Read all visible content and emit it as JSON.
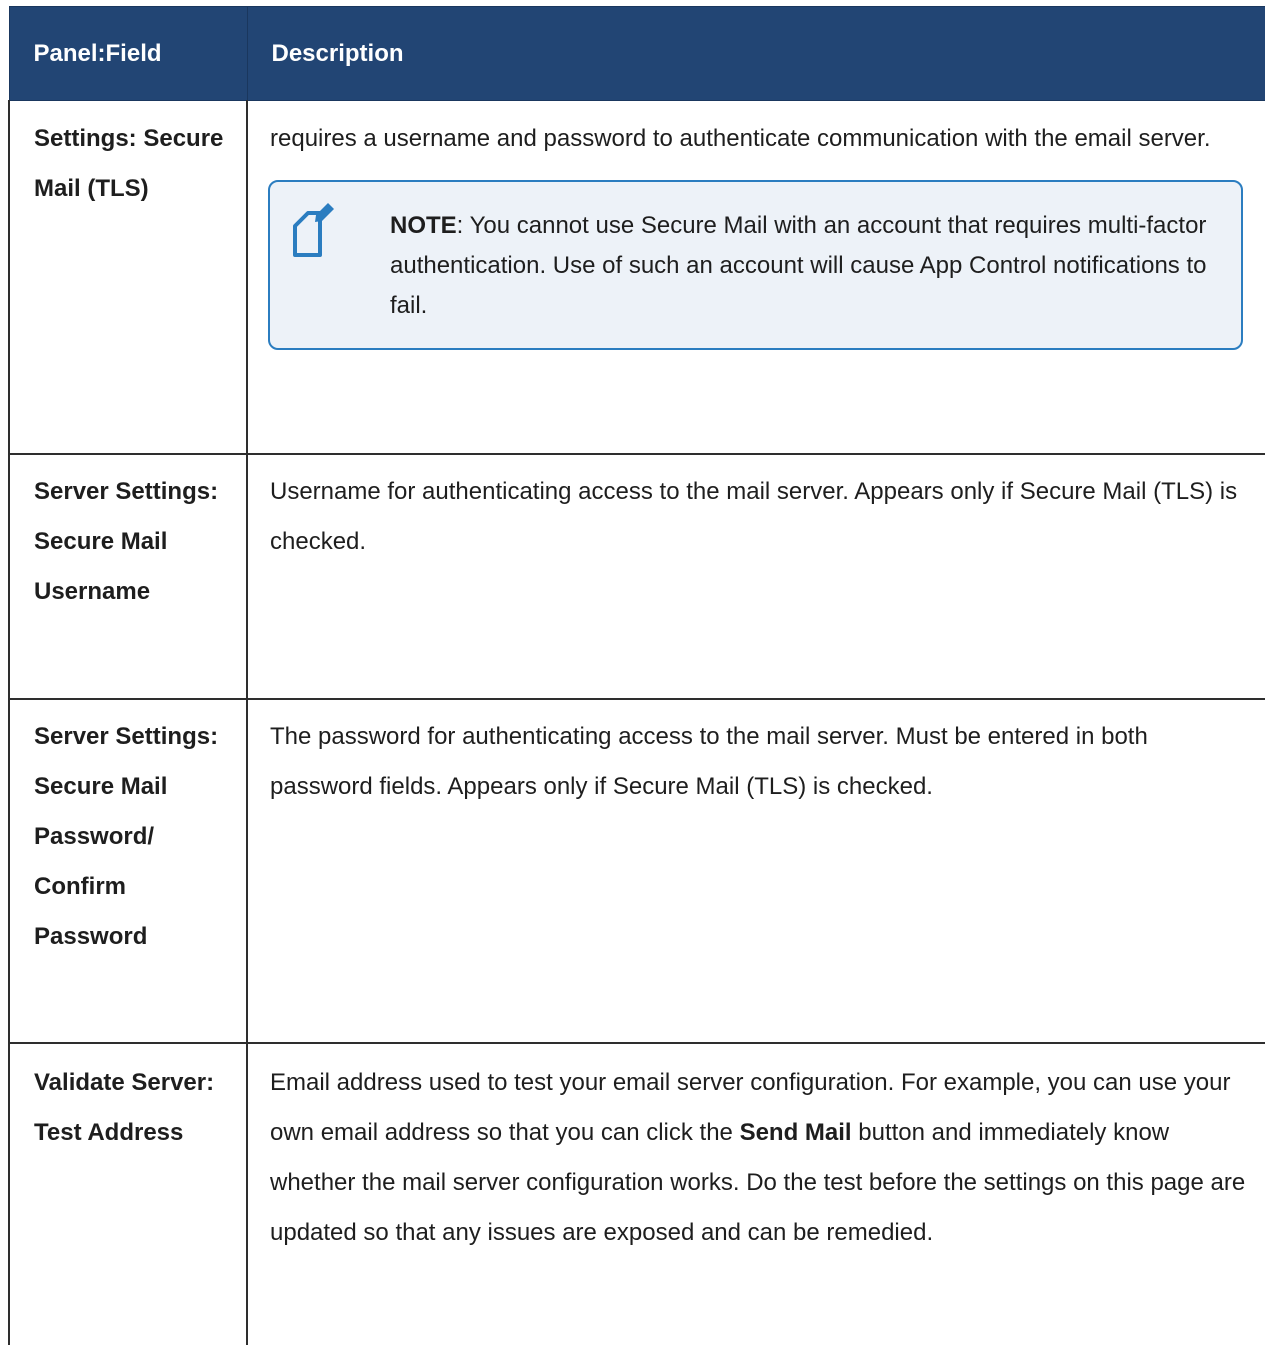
{
  "table": {
    "headers": {
      "field": "Panel:Field",
      "description": "Description"
    },
    "rows": [
      {
        "field": "Settings: Secure Mail (TLS)",
        "description": "requires a username and password to authenticate communication with the email server.",
        "note": {
          "label": "NOTE",
          "text": ": You cannot use Secure Mail with an account that requires multi-factor authentication. Use of such an account will cause App Control notifications to fail.",
          "icon": "note-pencil-icon"
        }
      },
      {
        "field": "Server Settings: Secure Mail Username",
        "description": "Username for authenticating access to the mail server. Appears only if Secure Mail (TLS) is checked."
      },
      {
        "field": "Server Settings: Secure Mail Password/ Confirm Password",
        "description": "The password for authenticating access to the mail server. Must be entered in both password fields. Appears only if Secure Mail (TLS) is checked."
      },
      {
        "field": "Validate Server: Test Address",
        "description_before": "Email address used to test your email server configuration. For example, you can use your own email address so that you can click the ",
        "description_bold": "Send Mail",
        "description_after": " button and immediately know whether the mail server configuration works. Do the test before the settings on this page are updated so that any issues are exposed and can be remedied."
      }
    ]
  },
  "colors": {
    "header_bg": "#224574",
    "note_border": "#2b7dc0",
    "note_bg": "#edf2f8"
  }
}
